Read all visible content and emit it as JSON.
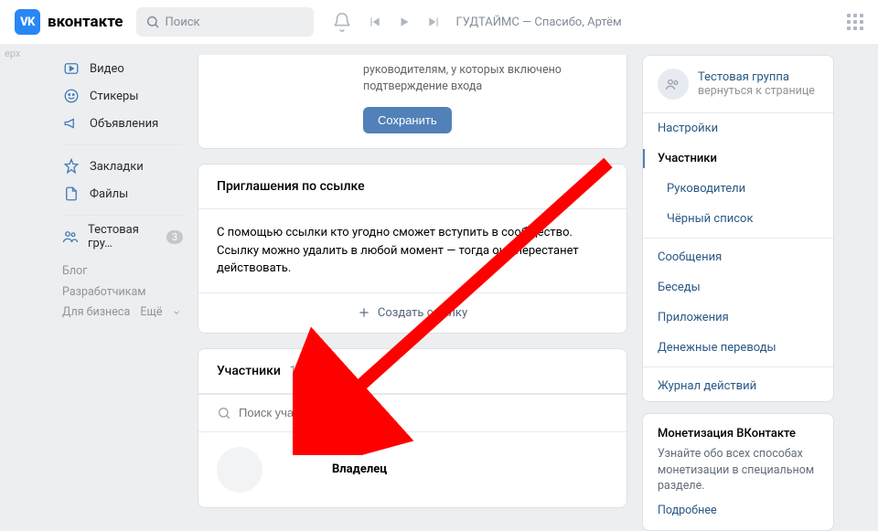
{
  "header": {
    "brand": "вконтакте",
    "search_placeholder": "Поиск",
    "track": "ГУДТАЙМС — Спасибо, Артём"
  },
  "left_nav": {
    "items": [
      {
        "label": "Видео"
      },
      {
        "label": "Стикеры"
      },
      {
        "label": "Объявления"
      }
    ],
    "items2": [
      {
        "label": "Закладки"
      },
      {
        "label": "Файлы"
      }
    ],
    "group_item": {
      "label": "Тестовая гру…",
      "badge": "3"
    },
    "footer": [
      "Блог",
      "Разработчикам",
      "Для бизнеса",
      "Ещё"
    ]
  },
  "card_notice": {
    "text": "руководителям, у которых включено подтверждение входа",
    "button": "Сохранить"
  },
  "invite_card": {
    "title": "Приглашения по ссылке",
    "body": "С помощью ссылки кто угодно сможет вступить в сообщество. Ссылку можно удалить в любой момент — тогда она перестанет действовать.",
    "action": "Создать ссылку"
  },
  "members_card": {
    "title": "Участники",
    "count": "1",
    "search_placeholder": "Поиск участников",
    "owner_role": "Владелец"
  },
  "right_panel": {
    "group_name": "Тестовая группа",
    "back": "вернуться к странице",
    "menu": [
      {
        "label": "Настройки",
        "active": false
      },
      {
        "label": "Участники",
        "active": true
      },
      {
        "label": "Руководители",
        "sub": true
      },
      {
        "label": "Чёрный список",
        "sub": true
      },
      {
        "label": "Сообщения"
      },
      {
        "label": "Беседы"
      },
      {
        "label": "Приложения"
      },
      {
        "label": "Денежные переводы"
      },
      {
        "label": "Журнал действий"
      }
    ]
  },
  "monetization": {
    "title": "Монетизация ВКонтакте",
    "text": "Узнайте обо всех способах монетизации в специальном разделе.",
    "link": "Подробнее"
  },
  "ghost": "ерх"
}
